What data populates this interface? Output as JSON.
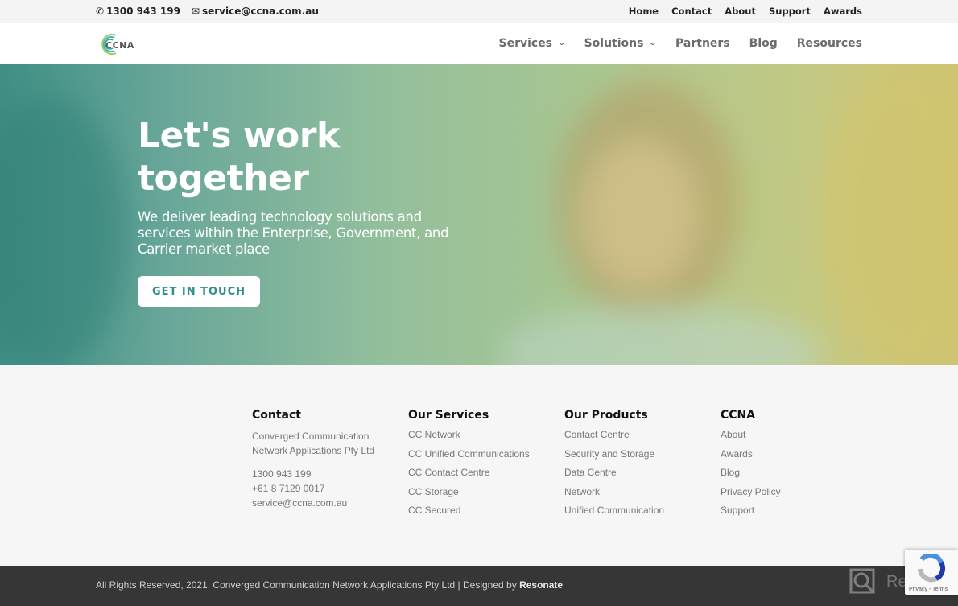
{
  "topbar": {
    "phone": "1300 943 199",
    "email": "service@ccna.com.au",
    "links": [
      "Home",
      "Contact",
      "About",
      "Support",
      "Awards"
    ]
  },
  "header": {
    "logo_text": "CCNA",
    "nav": [
      {
        "label": "Services",
        "dropdown": true
      },
      {
        "label": "Solutions",
        "dropdown": true
      },
      {
        "label": "Partners",
        "dropdown": false
      },
      {
        "label": "Blog",
        "dropdown": false
      },
      {
        "label": "Resources",
        "dropdown": false
      }
    ]
  },
  "hero": {
    "title": "Let's work together",
    "subtitle": "We deliver leading technology solutions and services within the Enterprise, Government, and Carrier market place",
    "cta_label": "GET IN TOUCH",
    "accent_color": "#2e8f8a"
  },
  "footer": {
    "contact": {
      "title": "Contact",
      "company_line1": "Converged Communication",
      "company_line2": "Network Applications Pty Ltd",
      "phone": "1300 943 199",
      "phone_alt": "+61 8 7129 0017",
      "email": "service@ccna.com.au"
    },
    "services": {
      "title": "Our Services",
      "items": [
        "CC Network",
        "CC Unified Communications",
        "CC Contact Centre",
        "CC Storage",
        "CC Secured"
      ]
    },
    "products": {
      "title": "Our Products",
      "items": [
        "Contact Centre",
        "Security and Storage",
        "Data Centre",
        "Network",
        "Unified Communication"
      ]
    },
    "ccna": {
      "title": "CCNA",
      "items": [
        "About",
        "Awards",
        "Blog",
        "Privacy Policy",
        "Support"
      ]
    }
  },
  "bottombar": {
    "copyright": "All Rights Reserved, 2021. Converged Communication Network Applications Pty Ltd | Designed by ",
    "designer": "Resonate"
  },
  "recaptcha": {
    "terms": "Privacy - Terms"
  },
  "watermark": {
    "text": "Revain"
  }
}
